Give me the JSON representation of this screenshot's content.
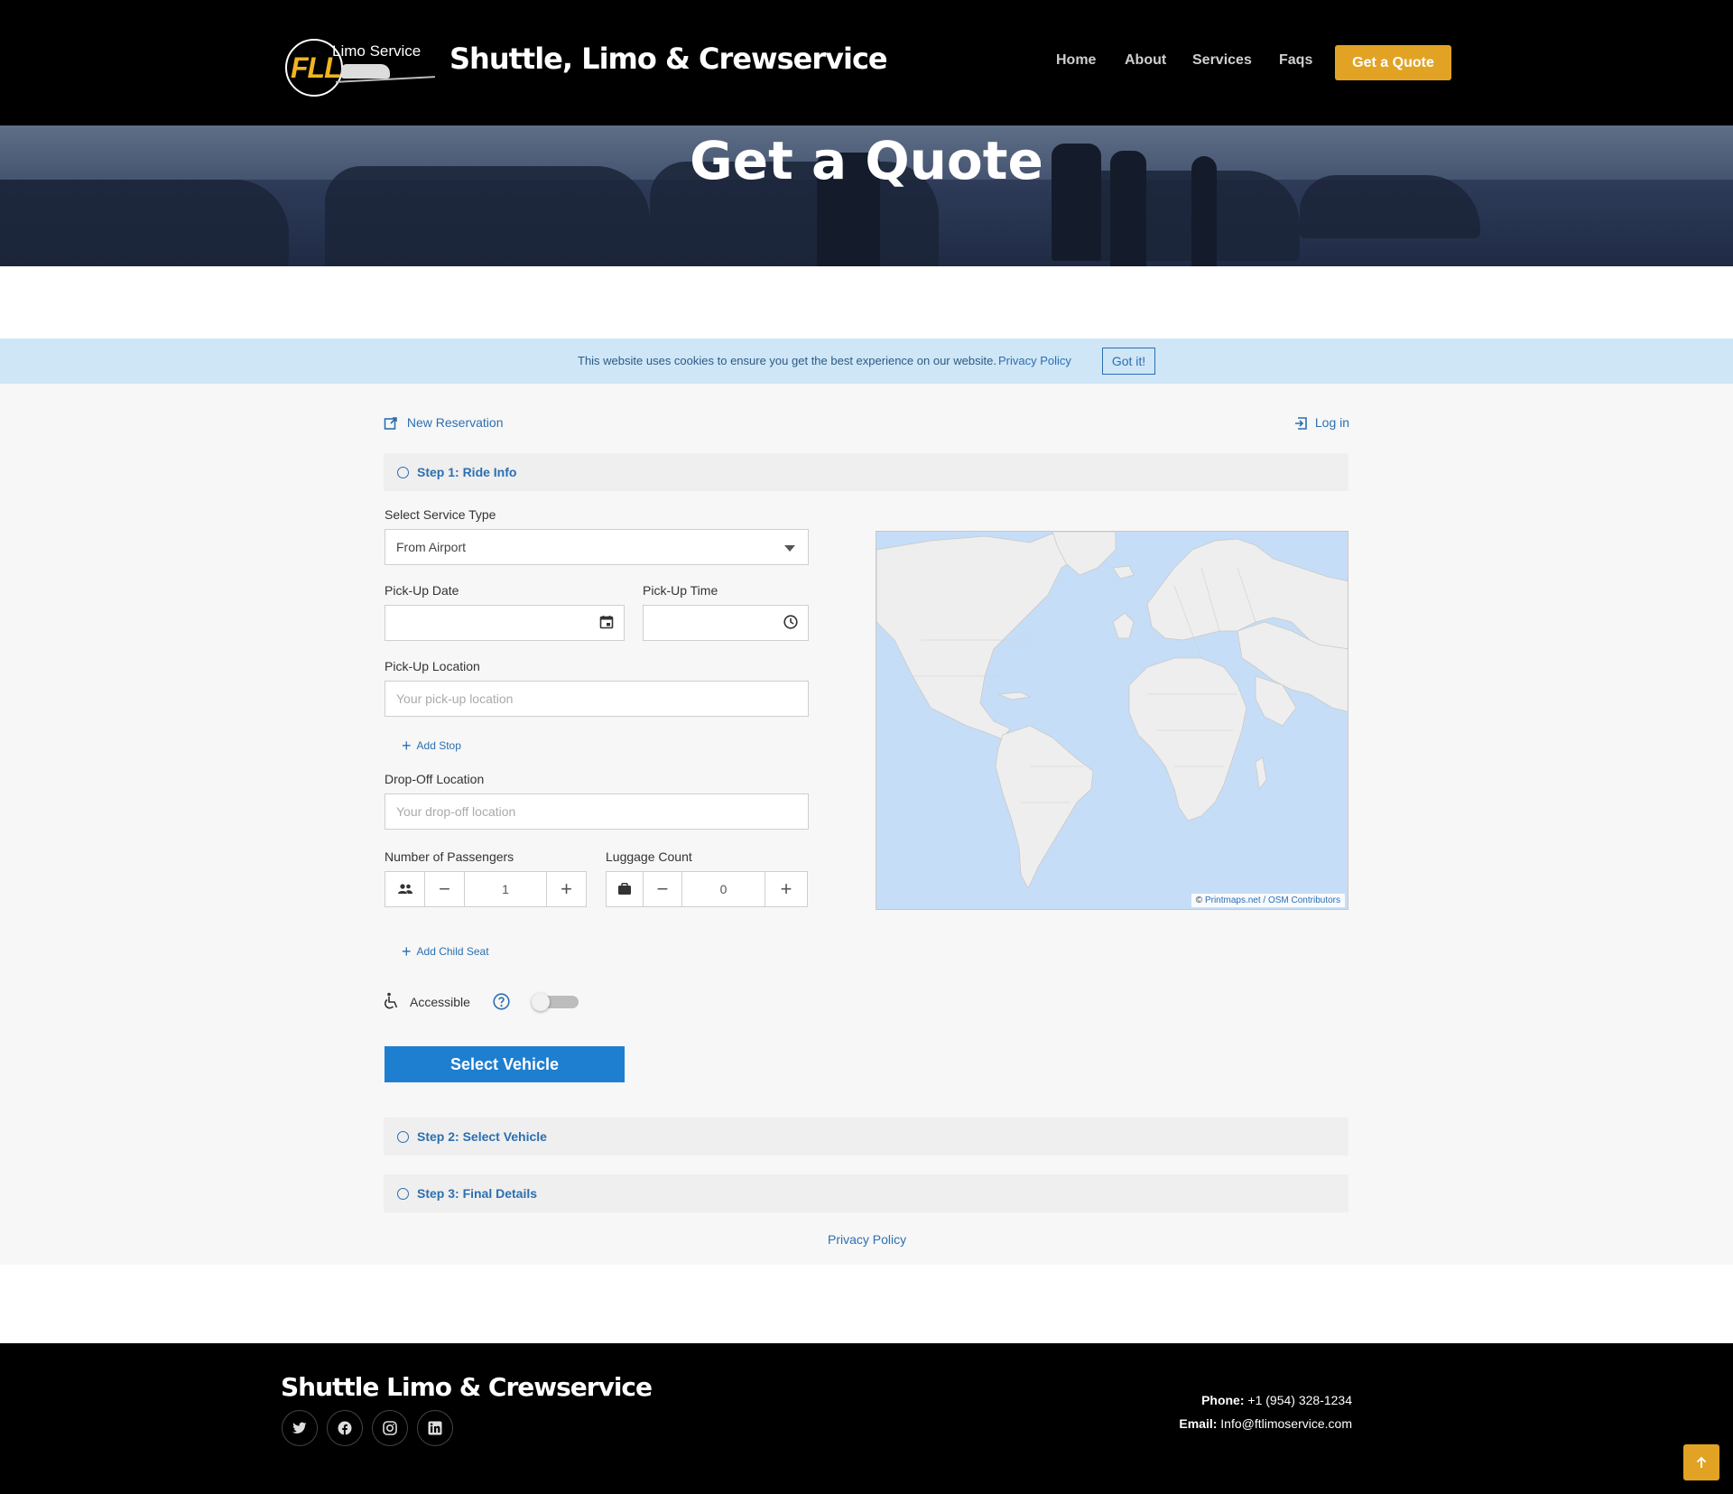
{
  "header": {
    "logo": {
      "main": "FLL",
      "sub": "Limo Service"
    },
    "title": "Shuttle, Limo & Crewservice",
    "nav": [
      "Home",
      "About",
      "Services",
      "Faqs"
    ],
    "cta": "Get a Quote"
  },
  "hero": {
    "title": "Get a Quote"
  },
  "cookie": {
    "message": "This website uses cookies to ensure you get the best experience on our website.",
    "policy_link": "Privacy Policy",
    "accept": "Got it!"
  },
  "form": {
    "new_reservation": "New Reservation",
    "login": "Log in",
    "steps": [
      "Step 1: Ride Info",
      "Step 2: Select Vehicle",
      "Step 3: Final Details"
    ],
    "service_type": {
      "label": "Select Service Type",
      "value": "From Airport"
    },
    "pickup_date": {
      "label": "Pick-Up Date",
      "value": ""
    },
    "pickup_time": {
      "label": "Pick-Up Time",
      "value": ""
    },
    "pickup_location": {
      "label": "Pick-Up Location",
      "placeholder": "Your pick-up location"
    },
    "add_stop": "Add Stop",
    "dropoff_location": {
      "label": "Drop-Off Location",
      "placeholder": "Your drop-off location"
    },
    "passengers": {
      "label": "Number of Passengers",
      "value": "1"
    },
    "luggage": {
      "label": "Luggage Count",
      "value": "0"
    },
    "add_child_seat": "Add Child Seat",
    "accessible": {
      "label": "Accessible",
      "enabled": false
    },
    "submit": "Select Vehicle",
    "privacy_policy": "Privacy Policy"
  },
  "map": {
    "attribution_prefix": "©",
    "attribution": "Printmaps.net / OSM Contributors"
  },
  "footer": {
    "title": "Shuttle Limo & Crewservice",
    "social": [
      "twitter-icon",
      "facebook-icon",
      "instagram-icon",
      "linkedin-icon"
    ],
    "phone_label": "Phone:",
    "phone": "+1 (954) 328-1234",
    "email_label": "Email:",
    "email": "Info@ftlimoservice.com"
  },
  "colors": {
    "accent": "#e2a324",
    "primary": "#1e7fd0",
    "link": "#2c6fb0",
    "cookie_bg": "#cfe6f7"
  }
}
